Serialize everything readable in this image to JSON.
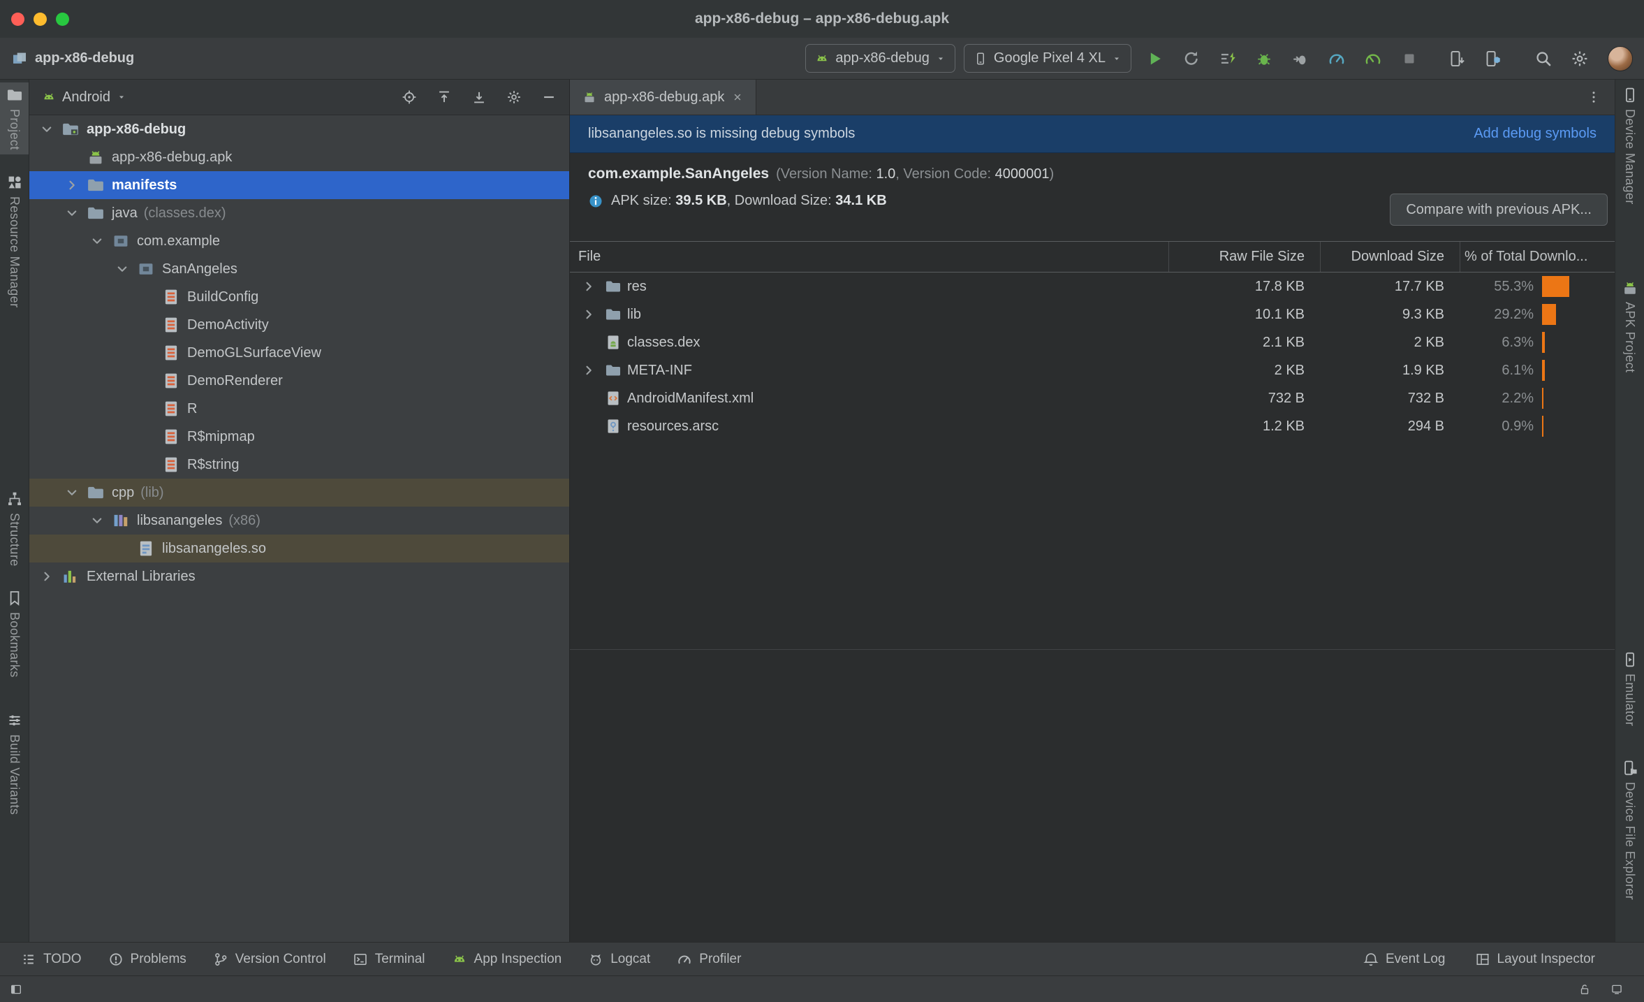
{
  "window": {
    "title": "app-x86-debug – app-x86-debug.apk"
  },
  "titlebar_buttons": [
    "close",
    "minimize",
    "zoom"
  ],
  "colors": {
    "selection_blue": "#2e65ca",
    "open_file_highlight": "#4e4a3b",
    "bar_orange": "#ec7615",
    "link_blue": "#5b9bf5",
    "banner_blue": "#1a3e68",
    "run_green": "#60b356"
  },
  "toolbar": {
    "project_name": "app-x86-debug",
    "run_config": {
      "label": "app-x86-debug",
      "icon": "android-head"
    },
    "device_selector": {
      "label": "Google Pixel 4 XL",
      "icon": "phone"
    },
    "actions": [
      {
        "name": "run",
        "icon": "play"
      },
      {
        "name": "apply-changes-restart",
        "icon": "restart"
      },
      {
        "name": "apply-code-changes",
        "icon": "apply-code"
      },
      {
        "name": "debug",
        "icon": "bug"
      },
      {
        "name": "attach-debugger",
        "icon": "attach"
      },
      {
        "name": "profiler",
        "icon": "gauge"
      },
      {
        "name": "profile-low-overhead",
        "icon": "gauge-green"
      },
      {
        "name": "stop",
        "icon": "stop"
      },
      {
        "name": "device-mirroring",
        "icon": "device-screenshot"
      },
      {
        "name": "device-manager",
        "icon": "device-cube"
      },
      {
        "name": "search-everywhere",
        "icon": "search"
      },
      {
        "name": "settings",
        "icon": "gear"
      }
    ]
  },
  "left_stripe": [
    {
      "label": "Project",
      "icon": "project-folder",
      "active": true
    },
    {
      "label": "Resource Manager",
      "icon": "resource-manager",
      "active": false
    },
    {
      "label": "Structure",
      "icon": "structure",
      "active": false
    },
    {
      "label": "Bookmarks",
      "icon": "bookmark",
      "active": false
    },
    {
      "label": "Build Variants",
      "icon": "build-variants",
      "active": false
    }
  ],
  "right_stripe": [
    {
      "label": "Device Manager",
      "icon": "device-manager-stripe",
      "active": false
    },
    {
      "label": "APK Project",
      "icon": "apk",
      "active": false
    },
    {
      "label": "Emulator",
      "icon": "emulator",
      "active": false
    },
    {
      "label": "Device File Explorer",
      "icon": "device-explorer",
      "active": false
    }
  ],
  "project_panel": {
    "view": "Android",
    "header_icons": [
      "select-opened-file",
      "collapse-all",
      "expand-all",
      "settings",
      "hide"
    ],
    "tree": [
      {
        "label": "app-x86-debug",
        "level": 0,
        "chevron": "down",
        "icon": "folder-root",
        "bold": true
      },
      {
        "label": "app-x86-debug.apk",
        "level": 1,
        "icon": "apk"
      },
      {
        "label": "manifests",
        "level": 1,
        "chevron": "right",
        "icon": "folder",
        "bold": true,
        "selected": true
      },
      {
        "label": "java",
        "suffix": "(classes.dex)",
        "level": 1,
        "chevron": "down",
        "icon": "folder"
      },
      {
        "label": "com.example",
        "level": 2,
        "chevron": "down",
        "icon": "package"
      },
      {
        "label": "SanAngeles",
        "level": 3,
        "chevron": "down",
        "icon": "package"
      },
      {
        "label": "BuildConfig",
        "level": 4,
        "icon": "class"
      },
      {
        "label": "DemoActivity",
        "level": 4,
        "icon": "class"
      },
      {
        "label": "DemoGLSurfaceView",
        "level": 4,
        "icon": "class"
      },
      {
        "label": "DemoRenderer",
        "level": 4,
        "icon": "class"
      },
      {
        "label": "R",
        "level": 4,
        "icon": "class"
      },
      {
        "label": "R$mipmap",
        "level": 4,
        "icon": "class"
      },
      {
        "label": "R$string",
        "level": 4,
        "icon": "class"
      },
      {
        "label": "cpp",
        "suffix": "(lib)",
        "level": 1,
        "chevron": "down",
        "icon": "folder",
        "highlight": true
      },
      {
        "label": "libsanangeles",
        "suffix": "(x86)",
        "level": 2,
        "chevron": "down",
        "icon": "library"
      },
      {
        "label": "libsanangeles.so",
        "level": 3,
        "icon": "so",
        "highlight": true
      },
      {
        "label": "External Libraries",
        "level": 0,
        "chevron": "right",
        "icon": "ext-lib"
      }
    ]
  },
  "editor": {
    "tab": {
      "title": "app-x86-debug.apk",
      "icon": "apk"
    },
    "banner": {
      "message": "libsanangeles.so is missing debug symbols",
      "action": "Add debug symbols"
    },
    "apk_info": {
      "package": "com.example.SanAngeles",
      "meta_open": "(Version Name: ",
      "version_name": "1.0",
      "meta_mid": ", Version Code: ",
      "version_code": "4000001",
      "meta_close": ")",
      "size_label": "APK size: ",
      "apk_size": "39.5 KB",
      "download_label": ", Download Size: ",
      "download_size": "34.1 KB",
      "compare_button": "Compare with previous APK..."
    },
    "table": {
      "columns": [
        "File",
        "Raw File Size",
        "Download Size",
        "% of Total Downlo..."
      ],
      "rows": [
        {
          "file": "res",
          "icon": "folder",
          "expandable": true,
          "raw": "17.8 KB",
          "download": "17.7 KB",
          "pct_label": "55.3%",
          "pct": 55.3
        },
        {
          "file": "lib",
          "icon": "folder",
          "expandable": true,
          "raw": "10.1 KB",
          "download": "9.3 KB",
          "pct_label": "29.2%",
          "pct": 29.2
        },
        {
          "file": "classes.dex",
          "icon": "file-dex",
          "expandable": false,
          "raw": "2.1 KB",
          "download": "2 KB",
          "pct_label": "6.3%",
          "pct": 6.3
        },
        {
          "file": "META-INF",
          "icon": "folder",
          "expandable": true,
          "raw": "2 KB",
          "download": "1.9 KB",
          "pct_label": "6.1%",
          "pct": 6.1
        },
        {
          "file": "AndroidManifest.xml",
          "icon": "file-xml",
          "expandable": false,
          "raw": "732 B",
          "download": "732 B",
          "pct_label": "2.2%",
          "pct": 2.2
        },
        {
          "file": "resources.arsc",
          "icon": "file-arsc",
          "expandable": false,
          "raw": "1.2 KB",
          "download": "294 B",
          "pct_label": "0.9%",
          "pct": 0.9
        }
      ]
    }
  },
  "bottom_bar": {
    "left": [
      {
        "label": "TODO",
        "icon": "todo"
      },
      {
        "label": "Problems",
        "icon": "problems"
      },
      {
        "label": "Version Control",
        "icon": "vcs"
      },
      {
        "label": "Terminal",
        "icon": "terminal"
      },
      {
        "label": "App Inspection",
        "icon": "app-inspection"
      },
      {
        "label": "Logcat",
        "icon": "logcat"
      },
      {
        "label": "Profiler",
        "icon": "profiler"
      }
    ],
    "right": [
      {
        "label": "Event Log",
        "icon": "event-log"
      },
      {
        "label": "Layout Inspector",
        "icon": "layout-inspector"
      }
    ]
  },
  "status_bar": {
    "left_icons": [
      "toolwindow-toggle"
    ],
    "right_icons": [
      "unlock",
      "notifications"
    ]
  }
}
